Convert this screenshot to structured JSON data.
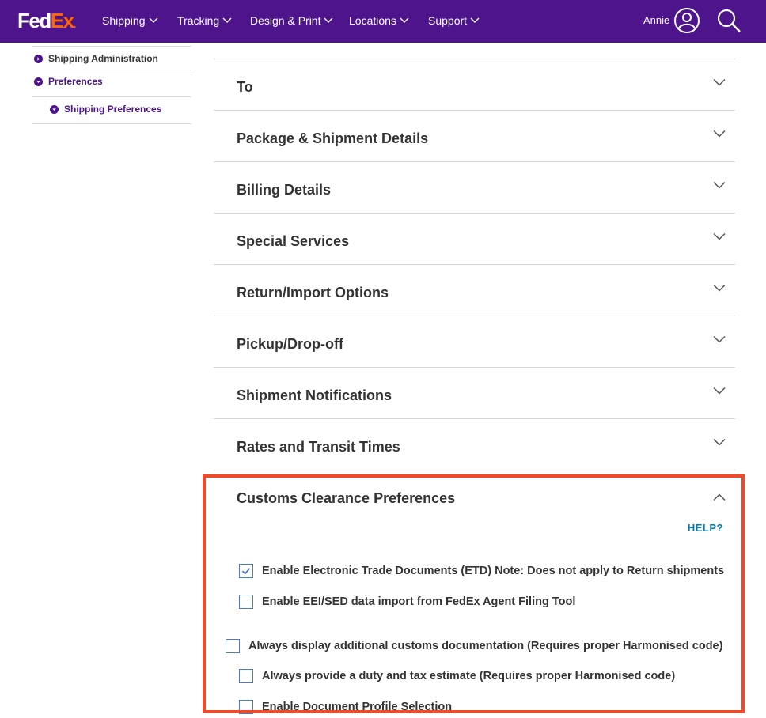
{
  "brand": {
    "part1": "Fed",
    "part2": "Ex",
    "suffix": "."
  },
  "nav": [
    {
      "label": "Shipping"
    },
    {
      "label": "Tracking"
    },
    {
      "label": "Design & Print"
    },
    {
      "label": "Locations"
    },
    {
      "label": "Support"
    }
  ],
  "user": {
    "name": "Annie"
  },
  "sidebar": {
    "items": [
      {
        "label": "Shipping Administration"
      },
      {
        "label": "Preferences"
      },
      {
        "label": "Shipping Preferences"
      }
    ]
  },
  "sections": [
    {
      "title": "To"
    },
    {
      "title": "Package & Shipment Details"
    },
    {
      "title": "Billing Details"
    },
    {
      "title": "Special Services"
    },
    {
      "title": "Return/Import Options"
    },
    {
      "title": "Pickup/Drop-off"
    },
    {
      "title": "Shipment Notifications"
    },
    {
      "title": "Rates and Transit Times"
    }
  ],
  "customs": {
    "title": "Customs Clearance Preferences",
    "help": "HELP?",
    "options": [
      {
        "label": "Enable Electronic Trade Documents (ETD) Note: Does not apply to Return shipments",
        "checked": true
      },
      {
        "label": "Enable EEI/SED data import from FedEx Agent Filing Tool",
        "checked": false
      },
      {
        "label": "Always display additional customs documentation (Requires proper Harmonised code)",
        "checked": false
      },
      {
        "label": "Always provide a duty and tax estimate (Requires proper Harmonised code)",
        "checked": false
      },
      {
        "label": "Enable Document Profile Selection",
        "checked": false
      }
    ]
  },
  "colors": {
    "brand_purple": "#4d148c",
    "brand_orange": "#ff6600",
    "link_blue": "#007ab7",
    "highlight": "#ee4b2b"
  }
}
